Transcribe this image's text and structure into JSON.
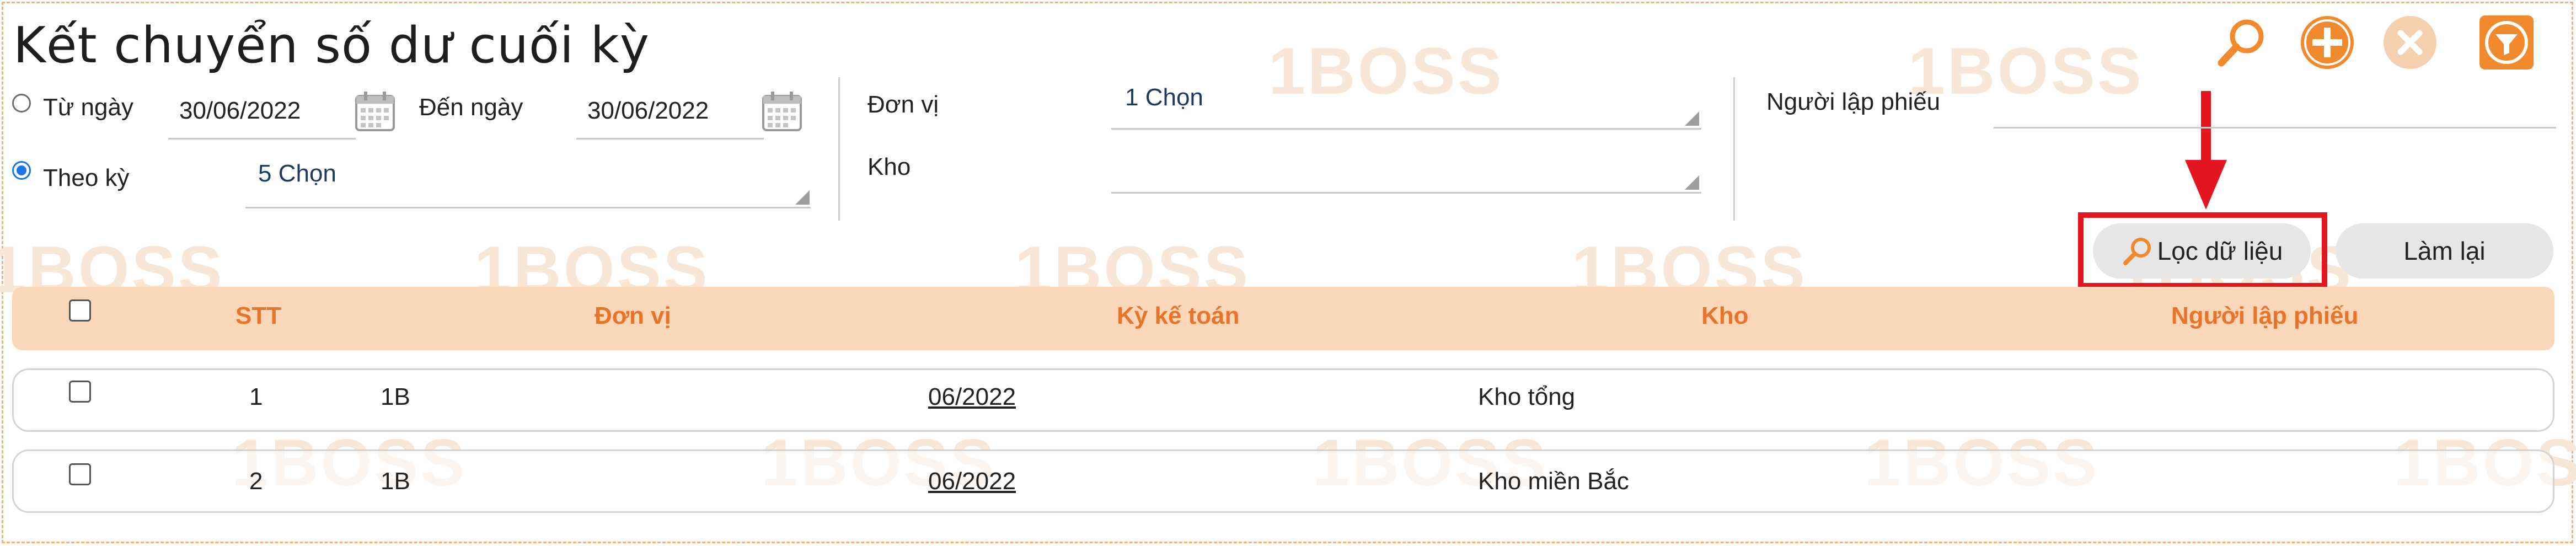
{
  "page": {
    "title": "Kết chuyển số dư cuối kỳ"
  },
  "watermark": "1BOSS",
  "toolbar": {
    "search_icon": "search-icon",
    "add_icon": "plus-circle-icon",
    "close_icon": "x-circle-icon",
    "filter_icon": "filter-icon"
  },
  "filters": {
    "tu_ngay_label": "Từ ngày",
    "tu_ngay_value": "30/06/2022",
    "den_ngay_label": "Đến ngày",
    "den_ngay_value": "30/06/2022",
    "theo_ky_label": "Theo kỳ",
    "theo_ky_value": "5 Chọn",
    "don_vi_label": "Đơn vị",
    "don_vi_value": "1 Chọn",
    "kho_label": "Kho",
    "kho_value": "",
    "nguoi_lap_label": "Người lập phiếu",
    "nguoi_lap_value": "",
    "selected_mode": "theo_ky"
  },
  "buttons": {
    "loc_du_lieu": "Lọc dữ liệu",
    "lam_lai": "Làm lại"
  },
  "colors": {
    "accent": "#f08a2c",
    "header_bg": "#f9d7b8",
    "header_text": "#e8742a",
    "highlight": "#e4161f"
  },
  "table": {
    "columns": [
      "STT",
      "Đơn vị",
      "Kỳ kế toán",
      "Kho",
      "Người lập phiếu"
    ],
    "rows": [
      {
        "stt": "1",
        "don_vi": "1B",
        "ky": "06/2022",
        "kho": "Kho tổng",
        "nguoi_lap": ""
      },
      {
        "stt": "2",
        "don_vi": "1B",
        "ky": "06/2022",
        "kho": "Kho miền Bắc",
        "nguoi_lap": ""
      }
    ]
  }
}
